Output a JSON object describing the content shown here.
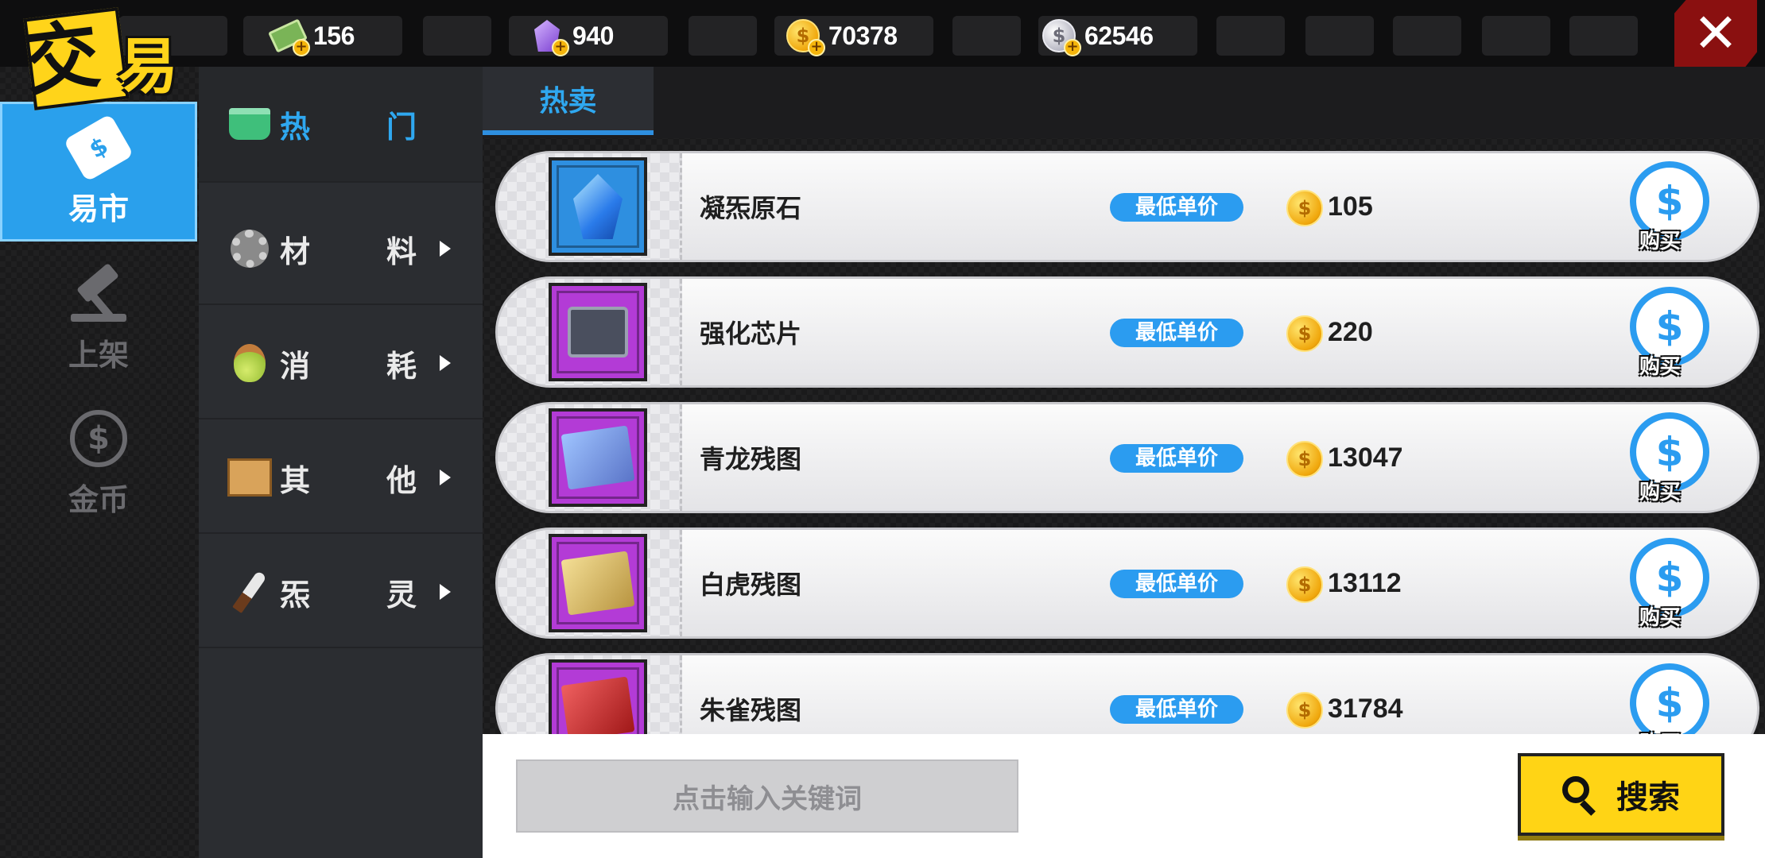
{
  "header": {
    "resources": [
      {
        "icon": "cash-icon",
        "value": "156"
      },
      {
        "icon": "gem-icon",
        "value": "940"
      },
      {
        "icon": "gold-coin-icon",
        "value": "70378"
      },
      {
        "icon": "silver-coin-icon",
        "value": "62546"
      }
    ],
    "plus_glyph": "+",
    "coin_glyph": "$",
    "close_glyph": "✕"
  },
  "logo": {
    "char1": "交",
    "char2": "易"
  },
  "leftnav": {
    "items": [
      {
        "label": "易市",
        "icon": "price-tag-icon",
        "active": true,
        "glyph": "$"
      },
      {
        "label": "上架",
        "icon": "gavel-icon",
        "active": false
      },
      {
        "label": "金币",
        "icon": "coin-icon",
        "active": false,
        "glyph": "$"
      }
    ]
  },
  "categories": [
    {
      "left": "热",
      "right": "门",
      "icon": "basket-icon",
      "active": true
    },
    {
      "left": "材",
      "right": "料",
      "icon": "gear-icon"
    },
    {
      "left": "消",
      "right": "耗",
      "icon": "potion-icon"
    },
    {
      "left": "其",
      "right": "他",
      "icon": "crate-icon"
    },
    {
      "left": "炁",
      "right": "灵",
      "icon": "knife-icon"
    }
  ],
  "tabs": [
    {
      "label": "热卖"
    }
  ],
  "items": [
    {
      "name": "凝炁原石",
      "pill": "最低单价",
      "price": "105",
      "buy": "购买",
      "frame": "blue",
      "icon": "crystal-icon"
    },
    {
      "name": "强化芯片",
      "pill": "最低单价",
      "price": "220",
      "buy": "购买",
      "frame": "purple",
      "icon": "chip-icon"
    },
    {
      "name": "青龙残图",
      "pill": "最低单价",
      "price": "13047",
      "buy": "购买",
      "frame": "purple",
      "icon": "map-icon"
    },
    {
      "name": "白虎残图",
      "pill": "最低单价",
      "price": "13112",
      "buy": "购买",
      "frame": "purple",
      "icon": "map-icon"
    },
    {
      "name": "朱雀残图",
      "pill": "最低单价",
      "price": "31784",
      "buy": "购买",
      "frame": "purple",
      "icon": "map-icon"
    }
  ],
  "search": {
    "placeholder": "点击输入关键词",
    "button": "搜索"
  },
  "colors": {
    "accent": "#2aa0ec",
    "search_button": "#ffd415",
    "close": "#8a1010"
  }
}
